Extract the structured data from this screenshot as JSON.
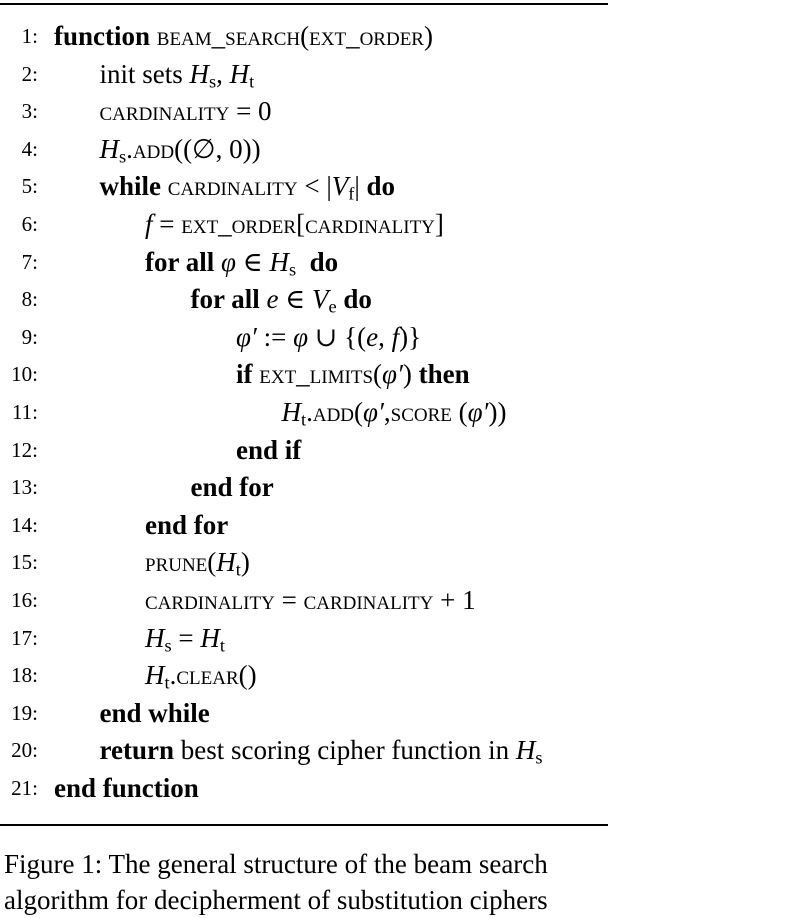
{
  "algorithm": {
    "lines": [
      {
        "n": "1:",
        "indent": 0,
        "parts": [
          {
            "t": "function",
            "s": "kw"
          },
          {
            "t": " "
          },
          {
            "t": "beam_search",
            "s": "sc"
          },
          {
            "t": "("
          },
          {
            "t": "ext_order",
            "s": "sc"
          },
          {
            "t": ")"
          }
        ]
      },
      {
        "n": "2:",
        "indent": 1,
        "parts": [
          {
            "t": "init sets "
          },
          {
            "t": "H",
            "s": "m"
          },
          {
            "t": "s",
            "s": "sub"
          },
          {
            "t": ", "
          },
          {
            "t": "H",
            "s": "m"
          },
          {
            "t": "t",
            "s": "sub"
          }
        ]
      },
      {
        "n": "3:",
        "indent": 1,
        "parts": [
          {
            "t": "cardinality",
            "s": "sc"
          },
          {
            "t": " = 0"
          }
        ]
      },
      {
        "n": "4:",
        "indent": 1,
        "parts": [
          {
            "t": "H",
            "s": "m"
          },
          {
            "t": "s",
            "s": "sub"
          },
          {
            "t": "."
          },
          {
            "t": "add",
            "s": "sc"
          },
          {
            "t": "((∅, 0))"
          }
        ]
      },
      {
        "n": "5:",
        "indent": 1,
        "parts": [
          {
            "t": "while",
            "s": "kw"
          },
          {
            "t": " "
          },
          {
            "t": "cardinality",
            "s": "sc"
          },
          {
            "t": " < |"
          },
          {
            "t": "V",
            "s": "m"
          },
          {
            "t": "f",
            "s": "sub"
          },
          {
            "t": "| "
          },
          {
            "t": "do",
            "s": "kw"
          }
        ]
      },
      {
        "n": "6:",
        "indent": 2,
        "parts": [
          {
            "t": "f",
            "s": "m"
          },
          {
            "t": " = "
          },
          {
            "t": "ext_order",
            "s": "sc"
          },
          {
            "t": "["
          },
          {
            "t": "cardinality",
            "s": "sc"
          },
          {
            "t": "]"
          }
        ]
      },
      {
        "n": "7:",
        "indent": 2,
        "parts": [
          {
            "t": "for all",
            "s": "kw"
          },
          {
            "t": " "
          },
          {
            "t": "φ",
            "s": "m"
          },
          {
            "t": " ∈ "
          },
          {
            "t": "H",
            "s": "m"
          },
          {
            "t": "s",
            "s": "sub"
          },
          {
            "t": "  "
          },
          {
            "t": "do",
            "s": "kw"
          }
        ]
      },
      {
        "n": "8:",
        "indent": 3,
        "parts": [
          {
            "t": "for all",
            "s": "kw"
          },
          {
            "t": " "
          },
          {
            "t": "e",
            "s": "m"
          },
          {
            "t": " ∈ "
          },
          {
            "t": "V",
            "s": "m"
          },
          {
            "t": "e",
            "s": "sub"
          },
          {
            "t": " "
          },
          {
            "t": "do",
            "s": "kw"
          }
        ]
      },
      {
        "n": "9:",
        "indent": 4,
        "parts": [
          {
            "t": "φ′",
            "s": "m"
          },
          {
            "t": " := "
          },
          {
            "t": "φ",
            "s": "m"
          },
          {
            "t": " ∪ {("
          },
          {
            "t": "e",
            "s": "m"
          },
          {
            "t": ", "
          },
          {
            "t": "f",
            "s": "m"
          },
          {
            "t": ")}"
          }
        ]
      },
      {
        "n": "10:",
        "indent": 4,
        "parts": [
          {
            "t": "if",
            "s": "kw"
          },
          {
            "t": " "
          },
          {
            "t": "ext_limits",
            "s": "sc"
          },
          {
            "t": "("
          },
          {
            "t": "φ′",
            "s": "m"
          },
          {
            "t": ") "
          },
          {
            "t": "then",
            "s": "kw"
          }
        ]
      },
      {
        "n": "11:",
        "indent": 5,
        "parts": [
          {
            "t": "H",
            "s": "m"
          },
          {
            "t": "t",
            "s": "sub"
          },
          {
            "t": "."
          },
          {
            "t": "add",
            "s": "sc"
          },
          {
            "t": "("
          },
          {
            "t": "φ′",
            "s": "m"
          },
          {
            "t": ","
          },
          {
            "t": "score",
            "s": "sc"
          },
          {
            "t": " ("
          },
          {
            "t": "φ′",
            "s": "m"
          },
          {
            "t": "))"
          }
        ]
      },
      {
        "n": "12:",
        "indent": 4,
        "parts": [
          {
            "t": "end if",
            "s": "kw"
          }
        ]
      },
      {
        "n": "13:",
        "indent": 3,
        "parts": [
          {
            "t": "end for",
            "s": "kw"
          }
        ]
      },
      {
        "n": "14:",
        "indent": 2,
        "parts": [
          {
            "t": "end for",
            "s": "kw"
          }
        ]
      },
      {
        "n": "15:",
        "indent": 2,
        "parts": [
          {
            "t": "prune",
            "s": "sc"
          },
          {
            "t": "("
          },
          {
            "t": "H",
            "s": "m"
          },
          {
            "t": "t",
            "s": "sub"
          },
          {
            "t": ")"
          }
        ]
      },
      {
        "n": "16:",
        "indent": 2,
        "parts": [
          {
            "t": "cardinality",
            "s": "sc"
          },
          {
            "t": " = "
          },
          {
            "t": "cardinality",
            "s": "sc"
          },
          {
            "t": " + 1"
          }
        ]
      },
      {
        "n": "17:",
        "indent": 2,
        "parts": [
          {
            "t": "H",
            "s": "m"
          },
          {
            "t": "s",
            "s": "sub"
          },
          {
            "t": " = "
          },
          {
            "t": "H",
            "s": "m"
          },
          {
            "t": "t",
            "s": "sub"
          }
        ]
      },
      {
        "n": "18:",
        "indent": 2,
        "parts": [
          {
            "t": "H",
            "s": "m"
          },
          {
            "t": "t",
            "s": "sub"
          },
          {
            "t": "."
          },
          {
            "t": "clear",
            "s": "sc"
          },
          {
            "t": "()"
          }
        ]
      },
      {
        "n": "19:",
        "indent": 1,
        "parts": [
          {
            "t": "end while",
            "s": "kw"
          }
        ]
      },
      {
        "n": "20:",
        "indent": 1,
        "parts": [
          {
            "t": "return",
            "s": "kw"
          },
          {
            "t": " best scoring cipher function in "
          },
          {
            "t": "H",
            "s": "m"
          },
          {
            "t": "s",
            "s": "sub"
          }
        ]
      },
      {
        "n": "21:",
        "indent": 0,
        "parts": [
          {
            "t": "end function",
            "s": "kw"
          }
        ]
      }
    ]
  },
  "caption": {
    "text": "Figure 1: The general structure of the beam search algorithm for decipherment of substitution ciphers"
  }
}
